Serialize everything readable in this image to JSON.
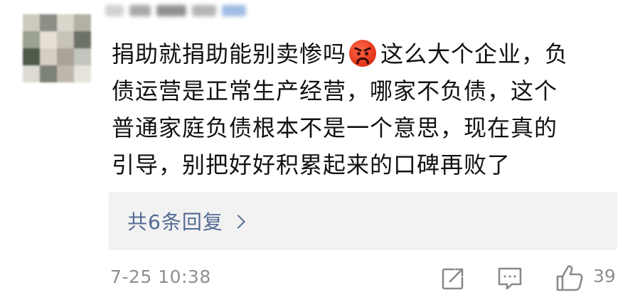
{
  "comment": {
    "username": "",
    "lines": [
      "捐助就捐助能别卖惨吗",
      "这么大个企业，负",
      "债运营是正常生产经营，哪家不负债，这个",
      "普通家庭负债根本不是一个意思，现在真的",
      "引导，别把好好积累起来的口碑再败了"
    ],
    "emoji": "angry-face-icon"
  },
  "replies": {
    "label": "共6条回复"
  },
  "footer": {
    "timestamp": "7-25 10:38",
    "like_count": "39"
  },
  "colors": {
    "link": "#536b95",
    "meta": "#8f8f8f",
    "text": "#111111",
    "reply_bg": "#f2f2f2",
    "emoji": "#e8391f"
  },
  "icons": {
    "share": "share-edit-icon",
    "comment": "comment-bubble-icon",
    "like": "thumbs-up-icon",
    "replies_chevron": "chevron-right-icon"
  }
}
